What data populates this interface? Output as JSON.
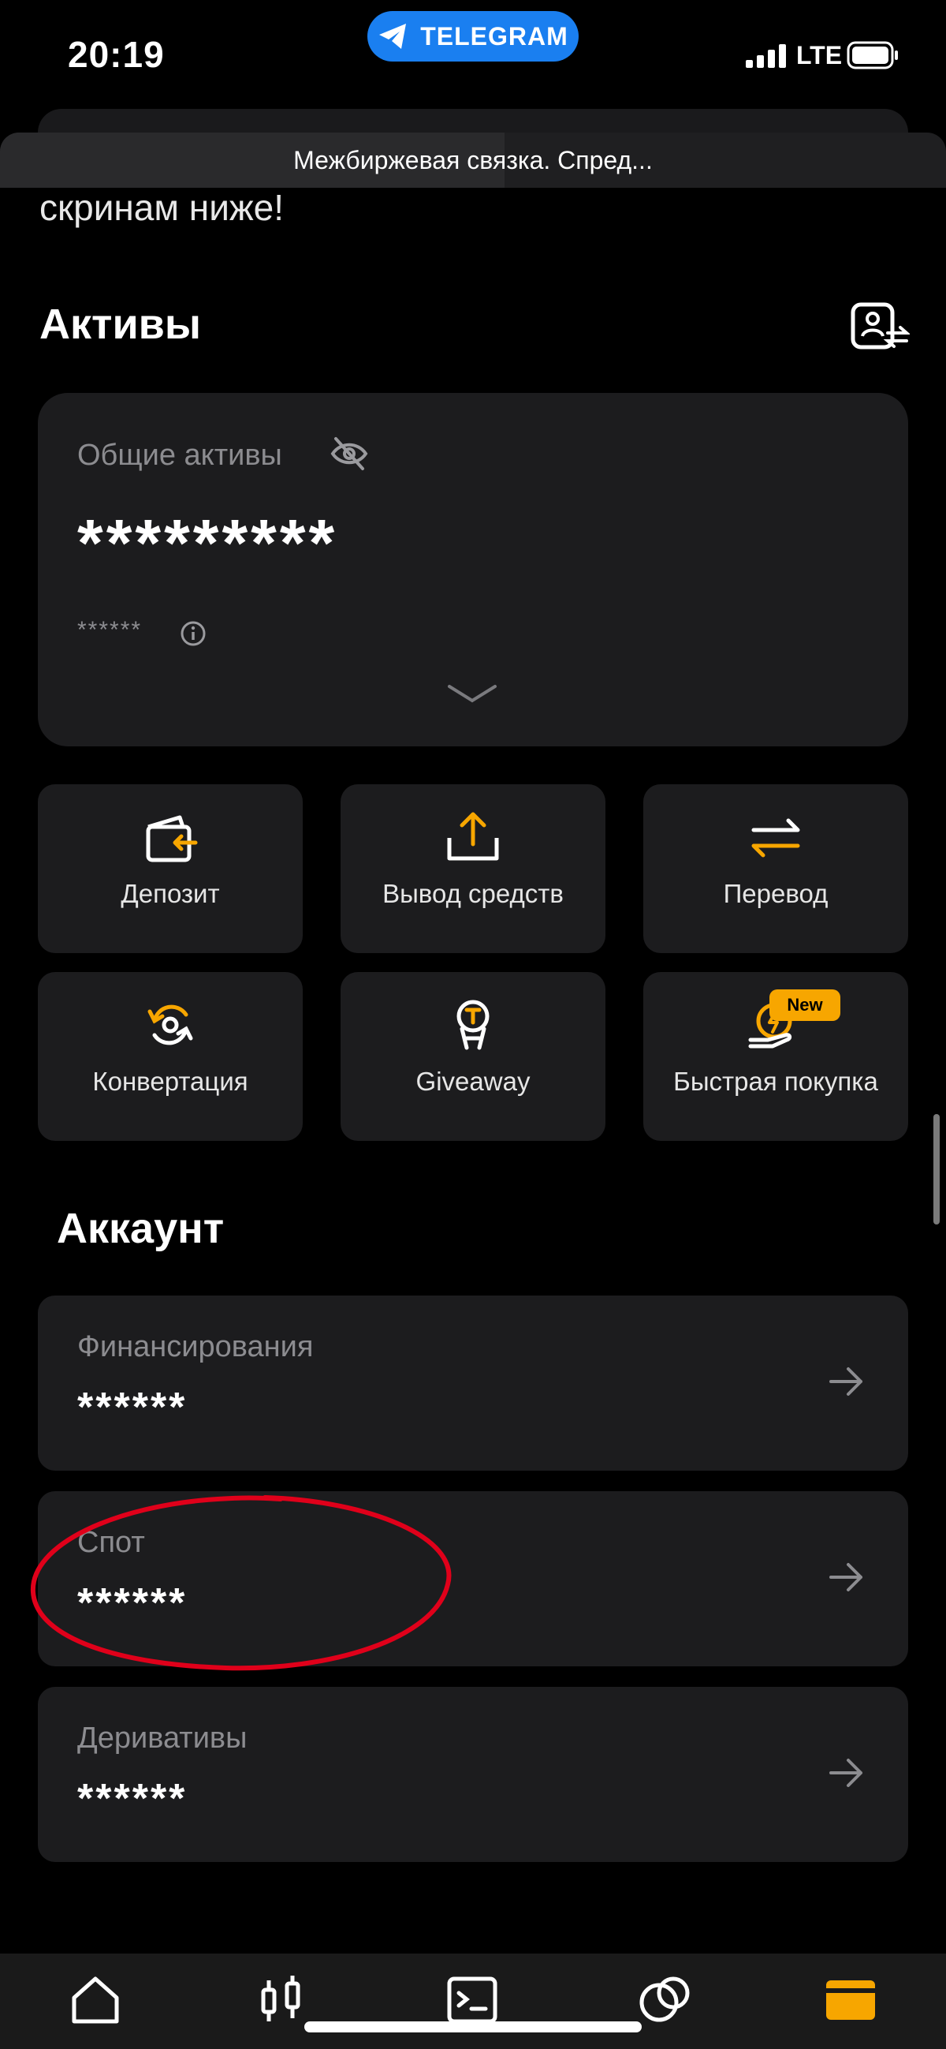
{
  "status_bar": {
    "time": "20:19",
    "app_pill": "TELEGRAM",
    "network": "LTE"
  },
  "header": {
    "title": "Межбиржевая связка. Спред...",
    "intro_text": "скринам ниже!"
  },
  "assets": {
    "heading": "Активы",
    "total_label": "Общие активы",
    "total_value": "*********",
    "total_sub": "******"
  },
  "actions": [
    {
      "label": "Депозит",
      "icon": "deposit-icon"
    },
    {
      "label": "Вывод средств",
      "icon": "withdraw-icon"
    },
    {
      "label": "Перевод",
      "icon": "transfer-icon"
    },
    {
      "label": "Конвертация",
      "icon": "convert-icon"
    },
    {
      "label": "Giveaway",
      "icon": "giveaway-icon"
    },
    {
      "label": "Быстрая покупка",
      "icon": "quick-buy-icon",
      "badge": "New"
    }
  ],
  "account": {
    "heading": "Аккаунт",
    "rows": [
      {
        "label": "Финансирования",
        "value": "******"
      },
      {
        "label": "Спот",
        "value": "******"
      },
      {
        "label": "Деривативы",
        "value": "******"
      }
    ]
  },
  "nav": [
    "home-icon",
    "markets-icon",
    "trade-icon",
    "earn-icon",
    "wallet-icon"
  ],
  "colors": {
    "accent": "#f7a600",
    "background": "#000000",
    "card": "#1c1c1e",
    "annotation": "#e0001a",
    "telegram": "#1a7ff0"
  }
}
